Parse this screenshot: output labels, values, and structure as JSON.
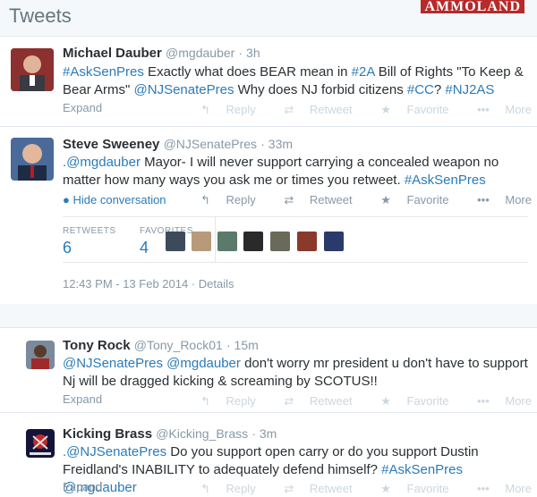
{
  "header": {
    "title": "Tweets",
    "watermark": "AMMOLAND"
  },
  "tweets": [
    {
      "name": "Michael Dauber",
      "handle": "@mgdauber",
      "time": "3h",
      "line1": [
        {
          "t": "#AskSenPres",
          "link": true
        },
        {
          "t": " Exactly what does BEAR mean in ",
          "link": false
        },
        {
          "t": "#2A",
          "link": true
        },
        {
          "t": " Bill of Rights \"To Keep &",
          "link": false
        }
      ],
      "line2": [
        {
          "t": "Bear Arms\" ",
          "link": false
        },
        {
          "t": "@NJSenatePres",
          "link": true
        },
        {
          "t": " Why does NJ forbid citizens ",
          "link": false
        },
        {
          "t": "#CC",
          "link": true
        },
        {
          "t": "? ",
          "link": false
        },
        {
          "t": "#NJ2AS",
          "link": true
        }
      ],
      "expand": "Expand"
    },
    {
      "name": "Steve Sweeney",
      "handle": "@NJSenatePres",
      "time": "33m",
      "line1": [
        {
          "t": ".@mgdauber",
          "link": true
        },
        {
          "t": " Mayor- I will never support carrying a concealed weapon no",
          "link": false
        }
      ],
      "line2": [
        {
          "t": "matter how many ways you ask me or times you retweet. ",
          "link": false
        },
        {
          "t": "#AskSenPres",
          "link": true
        }
      ],
      "hide": "Hide conversation",
      "retweets_label": "RETWEETS",
      "retweets": "6",
      "favorites_label": "FAVORITES",
      "favorites": "4",
      "timestamp": "12:43 PM - 13 Feb 2014 · Details"
    },
    {
      "name": "Tony Rock",
      "handle": "@Tony_Rock01",
      "time": "15m",
      "line1": [
        {
          "t": "@NJSenatePres",
          "link": true
        },
        {
          "t": " ",
          "link": false
        },
        {
          "t": "@mgdauber",
          "link": true
        },
        {
          "t": " don't worry mr president u don't have to support",
          "link": false
        }
      ],
      "line2": [
        {
          "t": "Nj will be dragged kicking & screaming by SCOTUS!!",
          "link": false
        }
      ],
      "expand": "Expand"
    },
    {
      "name": "Kicking Brass",
      "handle": "@Kicking_Brass",
      "time": "3m",
      "line1": [
        {
          "t": ".@NJSenatePres",
          "link": true
        },
        {
          "t": " Do you support open carry or do you support Dustin",
          "link": false
        }
      ],
      "line2": [
        {
          "t": "Freidland's INABILITY to adequately defend himself? ",
          "link": false
        },
        {
          "t": "#AskSenPres",
          "link": true
        },
        {
          "t": " ",
          "link": false
        },
        {
          "t": "@mgdauber",
          "link": true
        }
      ],
      "expand": "Expand"
    }
  ],
  "actions": {
    "reply": "Reply",
    "retweet": "Retweet",
    "favorite": "Favorite",
    "more": "More"
  },
  "icons": {
    "reply": "reply-icon",
    "retweet": "retweet-icon",
    "favorite": "star-icon",
    "more": "more-dots-icon",
    "conversation": "speech-bubble-icon"
  },
  "colors": {
    "link": "#2b7bb9",
    "text": "#292f33",
    "muted": "#8899a6",
    "action_faint": "#ccd6dd",
    "header_bg": "#f5f8fa",
    "watermark_bg": "#b52a2a"
  }
}
